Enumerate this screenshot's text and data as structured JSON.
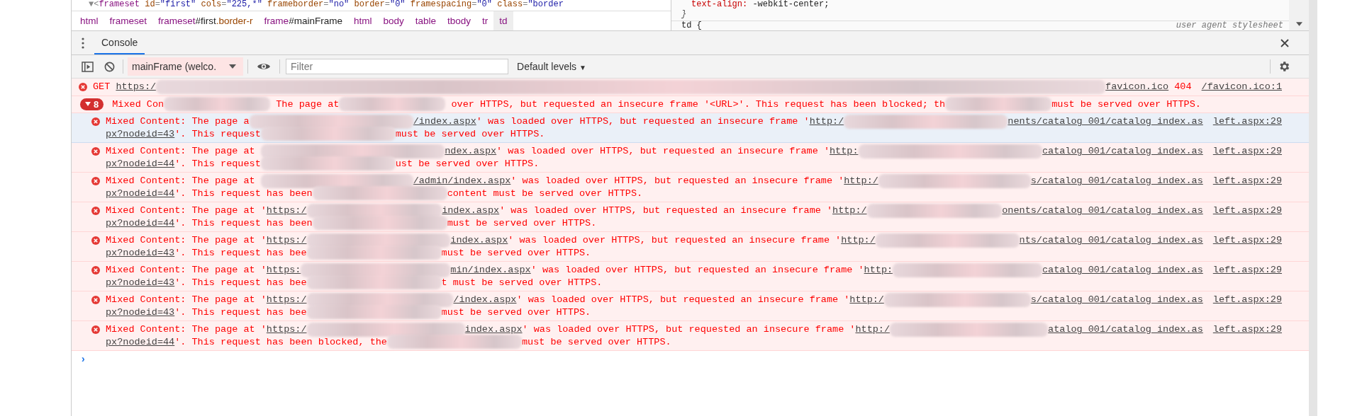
{
  "elements_panel": {
    "dom_line": [
      {
        "kind": "punct",
        "text": "▼<"
      },
      {
        "kind": "tag",
        "text": "frameset"
      },
      {
        "kind": "attr",
        "text": " id"
      },
      {
        "kind": "punct",
        "text": "="
      },
      {
        "kind": "value",
        "text": "\"first\""
      },
      {
        "kind": "attr",
        "text": " cols"
      },
      {
        "kind": "punct",
        "text": "="
      },
      {
        "kind": "value",
        "text": "\"225,*\""
      },
      {
        "kind": "attr",
        "text": " frameborder"
      },
      {
        "kind": "punct",
        "text": "="
      },
      {
        "kind": "value",
        "text": "\"no\""
      },
      {
        "kind": "attr",
        "text": " border"
      },
      {
        "kind": "punct",
        "text": "="
      },
      {
        "kind": "value",
        "text": "\"0\""
      },
      {
        "kind": "attr",
        "text": " framespacing"
      },
      {
        "kind": "punct",
        "text": "="
      },
      {
        "kind": "value",
        "text": "\"0\""
      },
      {
        "kind": "attr",
        "text": " class"
      },
      {
        "kind": "punct",
        "text": "="
      },
      {
        "kind": "value",
        "text": "\"border"
      }
    ],
    "breadcrumbs": [
      {
        "tag": "html",
        "selected": false
      },
      {
        "tag": "frameset",
        "selected": false
      },
      {
        "tag": "frameset",
        "id": "#first",
        "cls": ".border-r",
        "selected": false
      },
      {
        "tag": "frame",
        "id": "#mainFrame",
        "selected": false
      },
      {
        "tag": "html",
        "selected": false
      },
      {
        "tag": "body",
        "selected": false
      },
      {
        "tag": "table",
        "selected": false
      },
      {
        "tag": "tbody",
        "selected": false
      },
      {
        "tag": "tr",
        "selected": false
      },
      {
        "tag": "td",
        "selected": true
      }
    ],
    "styles": [
      {
        "kind": "declaration",
        "property": "text-align:",
        "value": "-webkit-center;"
      },
      {
        "kind": "brace",
        "text": "}"
      },
      {
        "kind": "selector",
        "text": "td {",
        "origin": "user agent stylesheet"
      }
    ]
  },
  "console": {
    "tabs": [
      {
        "label": "Console",
        "selected": true
      }
    ],
    "toolbar": {
      "context": "mainFrame (welco.",
      "filter_placeholder": "Filter",
      "levels_label": "Default levels",
      "levels_caret": "▼"
    },
    "messages": [
      {
        "kind": "error",
        "selected": false,
        "source": "/favicon.ico:1",
        "lines": [
          [
            {
              "kind": "text",
              "text": "GET "
            },
            {
              "kind": "link",
              "text": "https:/"
            },
            {
              "kind": "blur"
            },
            {
              "kind": "link",
              "text": "favicon.ico"
            },
            {
              "kind": "text",
              "text": " 404"
            }
          ]
        ]
      },
      {
        "kind": "group",
        "count": "8",
        "expanded": true,
        "lines": [
          [
            {
              "kind": "text",
              "text": "Mixed Con"
            },
            {
              "kind": "blur"
            },
            {
              "kind": "text",
              "text": " The page at"
            },
            {
              "kind": "blur"
            },
            {
              "kind": "text",
              "text": " over HTTPS, but requested an insecure frame '<URL>'. This request has been blocked; th"
            },
            {
              "kind": "blur"
            },
            {
              "kind": "text",
              "text": "must be served over HTTPS."
            }
          ]
        ],
        "children": [
          {
            "kind": "error",
            "selected": true,
            "source": "left.aspx:29",
            "lines": [
              [
                {
                  "kind": "text",
                  "text": "Mixed Content: The page a"
                },
                {
                  "kind": "blur"
                },
                {
                  "kind": "link",
                  "text": "/index.aspx"
                },
                {
                  "kind": "text",
                  "text": "' was loaded over HTTPS, but requested an insecure frame '"
                },
                {
                  "kind": "link",
                  "text": "http:/"
                },
                {
                  "kind": "blur"
                },
                {
                  "kind": "link",
                  "text": "nents/catalog_001/catalog_index.as"
                }
              ],
              [
                {
                  "kind": "link",
                  "text": "px?nodeid=43"
                },
                {
                  "kind": "text",
                  "text": "'. This request"
                },
                {
                  "kind": "blur"
                },
                {
                  "kind": "text",
                  "text": "must be served over HTTPS."
                }
              ]
            ]
          },
          {
            "kind": "error",
            "selected": false,
            "source": "left.aspx:29",
            "lines": [
              [
                {
                  "kind": "text",
                  "text": "Mixed Content: The page at "
                },
                {
                  "kind": "blur"
                },
                {
                  "kind": "link",
                  "text": "ndex.aspx"
                },
                {
                  "kind": "text",
                  "text": "' was loaded over HTTPS, but requested an insecure frame '"
                },
                {
                  "kind": "link",
                  "text": "http:"
                },
                {
                  "kind": "blur"
                },
                {
                  "kind": "link",
                  "text": "catalog_001/catalog_index.as"
                }
              ],
              [
                {
                  "kind": "link",
                  "text": "px?nodeid=44"
                },
                {
                  "kind": "text",
                  "text": "'. This request"
                },
                {
                  "kind": "blur"
                },
                {
                  "kind": "text",
                  "text": "ust be served over HTTPS."
                }
              ]
            ]
          },
          {
            "kind": "error",
            "selected": false,
            "source": "left.aspx:29",
            "lines": [
              [
                {
                  "kind": "text",
                  "text": "Mixed Content: The page at "
                },
                {
                  "kind": "blur"
                },
                {
                  "kind": "link",
                  "text": "/admin/index.aspx"
                },
                {
                  "kind": "text",
                  "text": "' was loaded over HTTPS, but requested an insecure frame '"
                },
                {
                  "kind": "link",
                  "text": "http:/"
                },
                {
                  "kind": "blur"
                },
                {
                  "kind": "link",
                  "text": "s/catalog_001/catalog_index.as"
                }
              ],
              [
                {
                  "kind": "link",
                  "text": "px?nodeid=44"
                },
                {
                  "kind": "text",
                  "text": "'. This request has been"
                },
                {
                  "kind": "blur"
                },
                {
                  "kind": "text",
                  "text": "content must be served over HTTPS."
                }
              ]
            ]
          },
          {
            "kind": "error",
            "selected": false,
            "source": "left.aspx:29",
            "lines": [
              [
                {
                  "kind": "text",
                  "text": "Mixed Content: The page at '"
                },
                {
                  "kind": "link",
                  "text": "https:/"
                },
                {
                  "kind": "blur"
                },
                {
                  "kind": "link",
                  "text": "index.aspx"
                },
                {
                  "kind": "text",
                  "text": "' was loaded over HTTPS, but requested an insecure frame '"
                },
                {
                  "kind": "link",
                  "text": "http:/"
                },
                {
                  "kind": "blur"
                },
                {
                  "kind": "link",
                  "text": "onents/catalog_001/catalog_index.as"
                }
              ],
              [
                {
                  "kind": "link",
                  "text": "px?nodeid=44"
                },
                {
                  "kind": "text",
                  "text": "'. This request has been"
                },
                {
                  "kind": "blur"
                },
                {
                  "kind": "text",
                  "text": "must be served over HTTPS."
                }
              ]
            ]
          },
          {
            "kind": "error",
            "selected": false,
            "source": "left.aspx:29",
            "lines": [
              [
                {
                  "kind": "text",
                  "text": "Mixed Content: The page at '"
                },
                {
                  "kind": "link",
                  "text": "https:/"
                },
                {
                  "kind": "blur"
                },
                {
                  "kind": "link",
                  "text": "index.aspx"
                },
                {
                  "kind": "text",
                  "text": "' was loaded over HTTPS, but requested an insecure frame '"
                },
                {
                  "kind": "link",
                  "text": "http:/"
                },
                {
                  "kind": "blur"
                },
                {
                  "kind": "link",
                  "text": "nts/catalog_001/catalog_index.as"
                }
              ],
              [
                {
                  "kind": "link",
                  "text": "px?nodeid=43"
                },
                {
                  "kind": "text",
                  "text": "'. This request has bee"
                },
                {
                  "kind": "blur"
                },
                {
                  "kind": "text",
                  "text": "must be served over HTTPS."
                }
              ]
            ]
          },
          {
            "kind": "error",
            "selected": false,
            "source": "left.aspx:29",
            "lines": [
              [
                {
                  "kind": "text",
                  "text": "Mixed Content: The page at '"
                },
                {
                  "kind": "link",
                  "text": "https:"
                },
                {
                  "kind": "blur"
                },
                {
                  "kind": "link",
                  "text": "min/index.aspx"
                },
                {
                  "kind": "text",
                  "text": "' was loaded over HTTPS, but requested an insecure frame '"
                },
                {
                  "kind": "link",
                  "text": "http:"
                },
                {
                  "kind": "blur"
                },
                {
                  "kind": "link",
                  "text": "catalog_001/catalog_index.as"
                }
              ],
              [
                {
                  "kind": "link",
                  "text": "px?nodeid=43"
                },
                {
                  "kind": "text",
                  "text": "'. This request has bee"
                },
                {
                  "kind": "blur"
                },
                {
                  "kind": "text",
                  "text": "t must be served over HTTPS."
                }
              ]
            ]
          },
          {
            "kind": "error",
            "selected": false,
            "source": "left.aspx:29",
            "lines": [
              [
                {
                  "kind": "text",
                  "text": "Mixed Content: The page at '"
                },
                {
                  "kind": "link",
                  "text": "https:/"
                },
                {
                  "kind": "blur"
                },
                {
                  "kind": "link",
                  "text": "/index.aspx"
                },
                {
                  "kind": "text",
                  "text": "' was loaded over HTTPS, but requested an insecure frame '"
                },
                {
                  "kind": "link",
                  "text": "http:/"
                },
                {
                  "kind": "blur"
                },
                {
                  "kind": "link",
                  "text": "s/catalog_001/catalog_index.as"
                }
              ],
              [
                {
                  "kind": "link",
                  "text": "px?nodeid=43"
                },
                {
                  "kind": "text",
                  "text": "'. This request has bee"
                },
                {
                  "kind": "blur"
                },
                {
                  "kind": "text",
                  "text": "must be served over HTTPS."
                }
              ]
            ]
          },
          {
            "kind": "error",
            "selected": false,
            "source": "left.aspx:29",
            "lines": [
              [
                {
                  "kind": "text",
                  "text": "Mixed Content: The page at '"
                },
                {
                  "kind": "link",
                  "text": "https:/"
                },
                {
                  "kind": "blur"
                },
                {
                  "kind": "link",
                  "text": "index.aspx"
                },
                {
                  "kind": "text",
                  "text": "' was loaded over HTTPS, but requested an insecure frame '"
                },
                {
                  "kind": "link",
                  "text": "http:/"
                },
                {
                  "kind": "blur"
                },
                {
                  "kind": "link",
                  "text": "atalog_001/catalog_index.as"
                }
              ],
              [
                {
                  "kind": "link",
                  "text": "px?nodeid=44"
                },
                {
                  "kind": "text",
                  "text": "'. This request has been blocked, the"
                },
                {
                  "kind": "blur"
                },
                {
                  "kind": "text",
                  "text": "must be served over HTTPS."
                }
              ]
            ]
          }
        ]
      }
    ],
    "prompt": "›"
  }
}
